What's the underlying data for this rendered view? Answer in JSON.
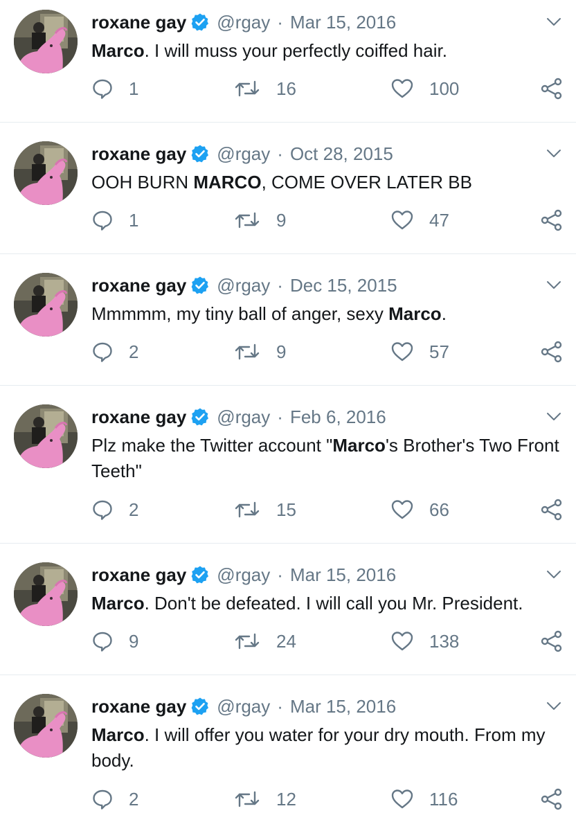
{
  "colors": {
    "text": "#14171a",
    "muted": "#657786",
    "verified": "#1da1f2",
    "divider": "#e6ecf0"
  },
  "icons": {
    "reply": "speech-bubble-icon",
    "retweet": "retweet-arrows-icon",
    "like": "heart-outline-icon",
    "share": "share-nodes-icon",
    "verified": "verified-badge-icon",
    "menu": "chevron-down-icon"
  },
  "tweets": [
    {
      "name": "roxane gay",
      "handle": "@rgay",
      "separator": "·",
      "date": "Mar 15, 2016",
      "text_parts": [
        {
          "bold": "Marco"
        },
        {
          "plain": ". I will muss your perfectly coiffed hair."
        }
      ],
      "replies": "1",
      "retweets": "16",
      "likes": "100"
    },
    {
      "name": "roxane gay",
      "handle": "@rgay",
      "separator": "·",
      "date": "Oct 28, 2015",
      "text_parts": [
        {
          "plain": "OOH BURN "
        },
        {
          "bold": "MARCO"
        },
        {
          "plain": ", COME OVER LATER BB"
        }
      ],
      "replies": "1",
      "retweets": "9",
      "likes": "47"
    },
    {
      "name": "roxane gay",
      "handle": "@rgay",
      "separator": "·",
      "date": "Dec 15, 2015",
      "text_parts": [
        {
          "plain": "Mmmmm, my tiny ball of anger, sexy "
        },
        {
          "bold": "Marco"
        },
        {
          "plain": "."
        }
      ],
      "replies": "2",
      "retweets": "9",
      "likes": "57"
    },
    {
      "name": "roxane gay",
      "handle": "@rgay",
      "separator": "·",
      "date": "Feb 6, 2016",
      "text_parts": [
        {
          "plain": "Plz make the Twitter account \""
        },
        {
          "bold": "Marco"
        },
        {
          "plain": "'s Brother's Two Front Teeth\""
        }
      ],
      "replies": "2",
      "retweets": "15",
      "likes": "66"
    },
    {
      "name": "roxane gay",
      "handle": "@rgay",
      "separator": "·",
      "date": "Mar 15, 2016",
      "text_parts": [
        {
          "bold": "Marco"
        },
        {
          "plain": ". Don't be defeated. I will call you Mr. President."
        }
      ],
      "replies": "9",
      "retweets": "24",
      "likes": "138"
    },
    {
      "name": "roxane gay",
      "handle": "@rgay",
      "separator": "·",
      "date": "Mar 15, 2016",
      "text_parts": [
        {
          "bold": "Marco"
        },
        {
          "plain": ". I will offer you water for your dry mouth. From my body."
        }
      ],
      "replies": "2",
      "retweets": "12",
      "likes": "116"
    }
  ]
}
